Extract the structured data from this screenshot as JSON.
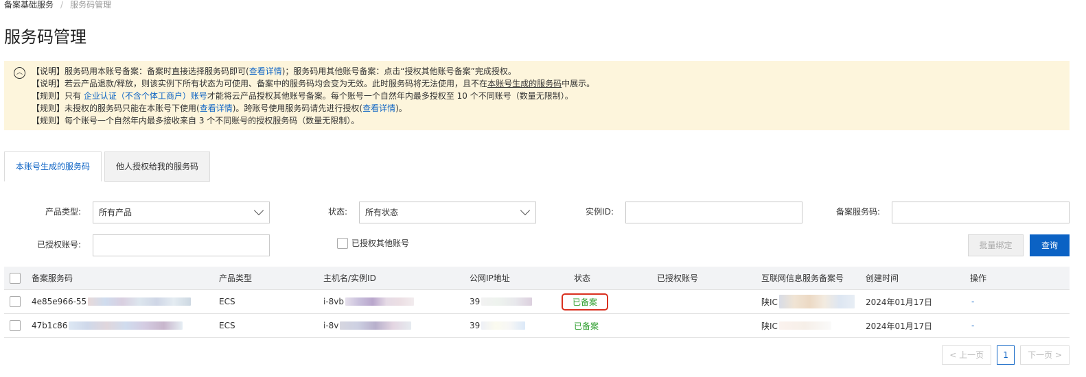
{
  "breadcrumb": {
    "parent": "备案基础服务",
    "sep": "/",
    "current": "服务码管理"
  },
  "page_title": "服务码管理",
  "notice": {
    "toggle_icon": "collapse-up-icon",
    "line1_a": "【说明】服务码用本账号备案：备案时直接选择服务码即可(",
    "line1_link": "查看详情",
    "line1_b": ")；服务码用其他账号备案：点击“授权其他账号备案”完成授权。",
    "line2_a": "【说明】若云产品退款/释放，则该实例下所有状态为可使用、备案中的服务码均会变为无效。此时服务码将无法使用，且不在",
    "line2_underline": "本账号生成的服务码",
    "line2_b": "中展示。",
    "line3_a": "【规则】只有 ",
    "line3_link": "企业认证（不含个体工商户）账号",
    "line3_b": "才能将云产品授权其他账号备案。每个账号一个自然年内最多授权至 10 个不同账号（数量无限制）。",
    "line4_a": "【规则】未授权的服务码只能在本账号下使用(",
    "line4_link1": "查看详情",
    "line4_b": ")。跨账号使用服务码请先进行授权(",
    "line4_link2": "查看详情",
    "line4_c": ")。",
    "line5": "【规则】每个账号一个自然年内最多接收来自 3 个不同账号的授权服务码（数量无限制）。"
  },
  "tabs": [
    {
      "label": "本账号生成的服务码",
      "active": true
    },
    {
      "label": "他人授权给我的服务码",
      "active": false
    }
  ],
  "filters": {
    "product_type_label": "产品类型:",
    "product_type_value": "所有产品",
    "status_label": "状态:",
    "status_value": "所有状态",
    "instance_id_label": "实例ID:",
    "instance_id_value": "",
    "service_code_label": "备案服务码:",
    "service_code_value": "",
    "authorized_account_label": "已授权账号:",
    "authorized_account_value": "",
    "authorized_others_label": "已授权其他账号",
    "batch_bind_label": "批量绑定",
    "query_label": "查询"
  },
  "table": {
    "headers": [
      "备案服务码",
      "产品类型",
      "主机名/实例ID",
      "公网IP地址",
      "状态",
      "已授权账号",
      "互联网信息服务备案号",
      "创建时间",
      "操作"
    ],
    "rows": [
      {
        "code": "4e85e966-55",
        "product": "ECS",
        "instance": "i-8vb",
        "ip": "39",
        "status": "已备案",
        "authorized": "",
        "icp": "陕IC",
        "created": "2024年01月17日",
        "action": "-"
      },
      {
        "code": "47b1c86",
        "product": "ECS",
        "instance": "i-8v",
        "ip": "39",
        "status": "已备案",
        "authorized": "",
        "icp": "陕IC",
        "created": "2024年01月17日",
        "action": "-"
      }
    ]
  },
  "pagination": {
    "prev": "上一页",
    "page": "1",
    "next": "下一页"
  },
  "colors": {
    "accent": "#0b62c4",
    "notice_bg": "#fdf5dc",
    "status_green": "#2e9e2e",
    "highlight_red": "#d9301f"
  }
}
